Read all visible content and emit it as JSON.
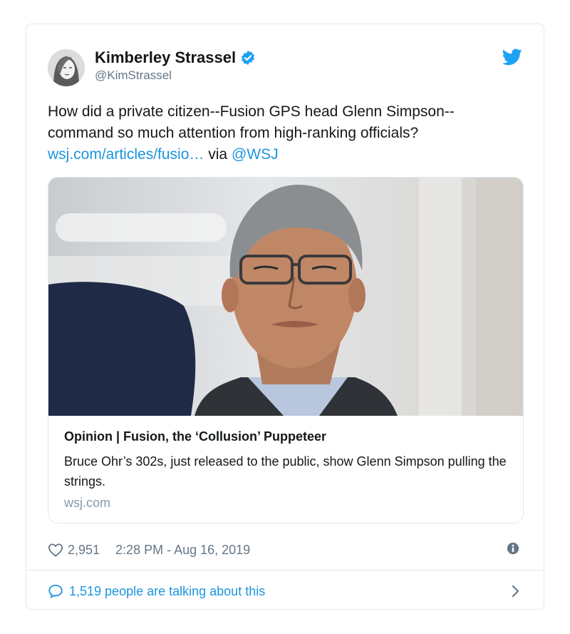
{
  "author": {
    "name": "Kimberley Strassel",
    "handle": "@KimStrassel",
    "verified": true
  },
  "tweet": {
    "text_line1": "How did a private citizen--Fusion GPS head Glenn Simpson--",
    "text_line2": "command so much attention from high-ranking officials?",
    "link_text": "wsj.com/articles/fusio…",
    "via_text": "via",
    "mention": "@WSJ"
  },
  "link_card": {
    "title": "Opinion | Fusion, the ‘Collusion’ Puppeteer",
    "description": "Bruce Ohr’s 302s, just released to the public, show Glenn Simpson pulling the strings.",
    "domain": "wsj.com"
  },
  "meta": {
    "likes": "2,951",
    "timestamp": "2:28 PM - Aug 16, 2019"
  },
  "footer": {
    "talking": "1,519 people are talking about this"
  },
  "colors": {
    "link": "#1b95e0",
    "text": "#14171a",
    "secondary": "#657786",
    "border": "#e1e8ed"
  },
  "icons": [
    "verified-badge-icon",
    "twitter-bird-icon",
    "heart-icon",
    "info-icon",
    "speech-bubble-icon",
    "chevron-right-icon"
  ]
}
